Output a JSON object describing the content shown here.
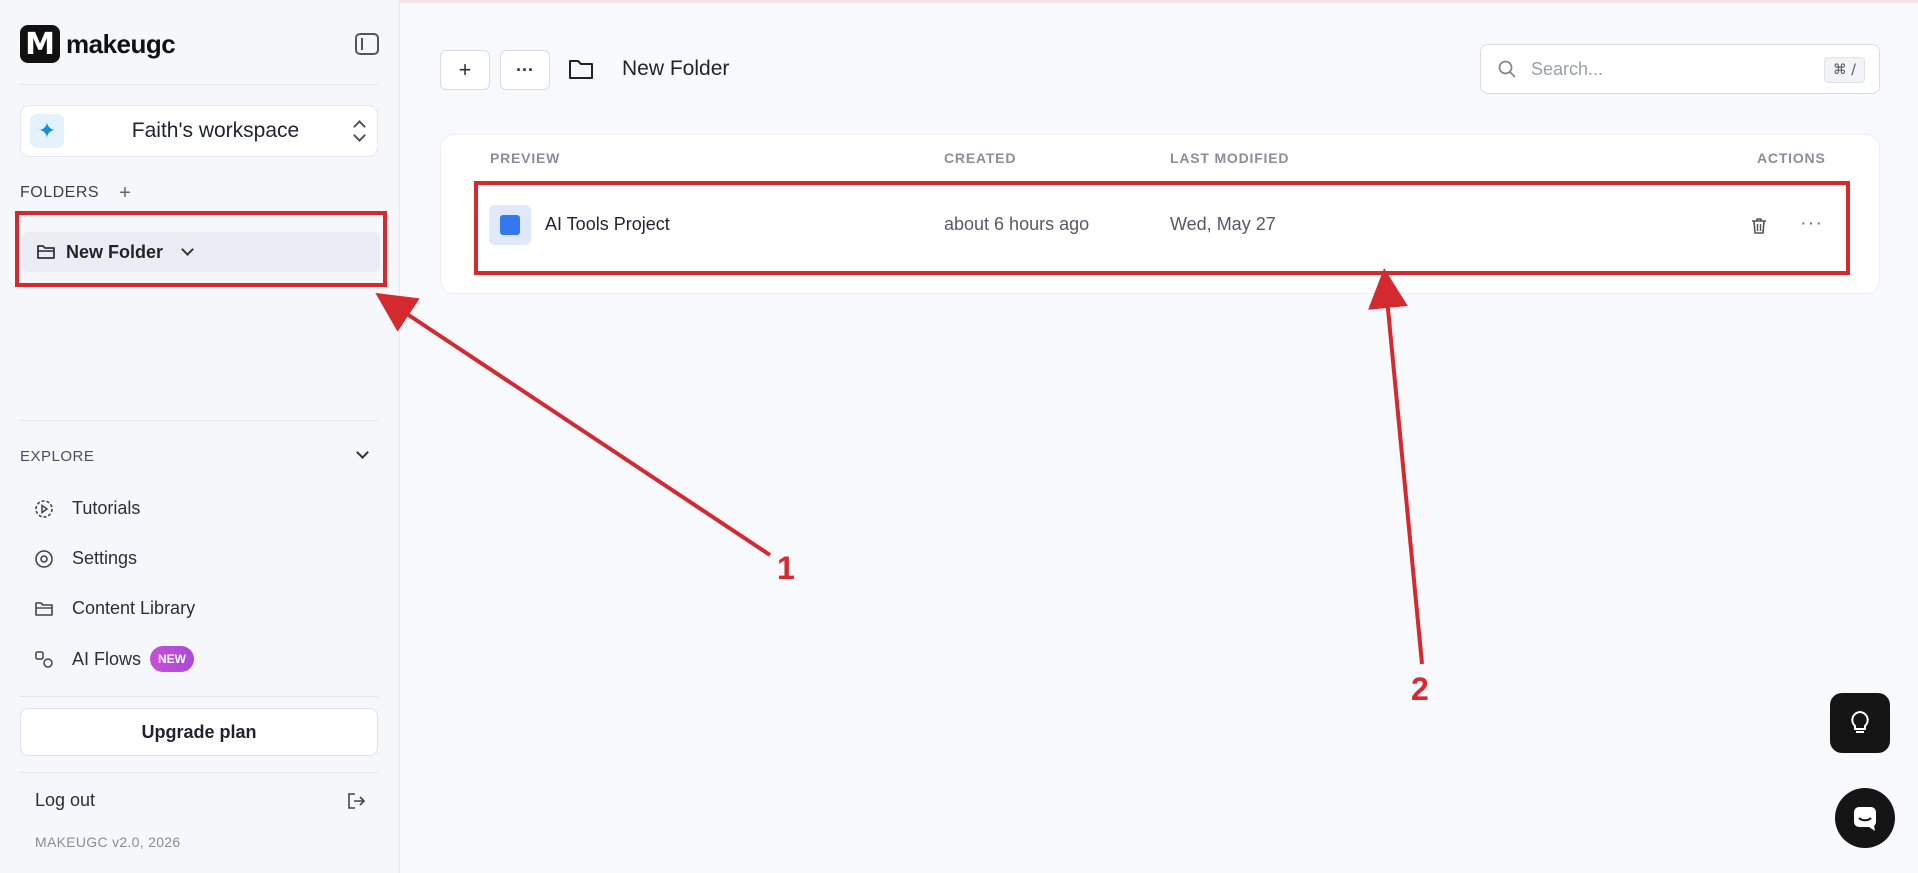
{
  "app": {
    "logo_letter": "M",
    "name": "makeugc",
    "version": "MAKEUGC v2.0, 2026"
  },
  "workspace": {
    "name": "Faith's workspace",
    "icon": "sparkle-icon"
  },
  "folders": {
    "heading": "FOLDERS",
    "add_label": "+",
    "items": [
      {
        "label": "New Folder"
      }
    ]
  },
  "explore": {
    "heading": "EXPLORE",
    "items": [
      {
        "label": "Tutorials",
        "icon": "play-circle-icon"
      },
      {
        "label": "Settings",
        "icon": "settings-icon"
      },
      {
        "label": "Content Library",
        "icon": "folder-icon"
      },
      {
        "label": "AI Flows",
        "icon": "flows-icon",
        "badge": "NEW"
      }
    ]
  },
  "upgrade_label": "Upgrade plan",
  "logout_label": "Log out",
  "toolbar": {
    "add_label": "+",
    "more_label": "···"
  },
  "page": {
    "title": "New Folder"
  },
  "search": {
    "placeholder": "Search...",
    "shortcut": "⌘ /"
  },
  "table": {
    "columns": {
      "preview": "PREVIEW",
      "created": "CREATED",
      "modified": "LAST MODIFIED",
      "actions": "ACTIONS"
    },
    "rows": [
      {
        "name": "AI Tools Project",
        "created": "about 6 hours ago",
        "modified": "Wed, May 27",
        "thumb_color": "#3478f0"
      }
    ]
  },
  "annotations": {
    "one": "1",
    "two": "2",
    "color": "#d42a2f"
  }
}
